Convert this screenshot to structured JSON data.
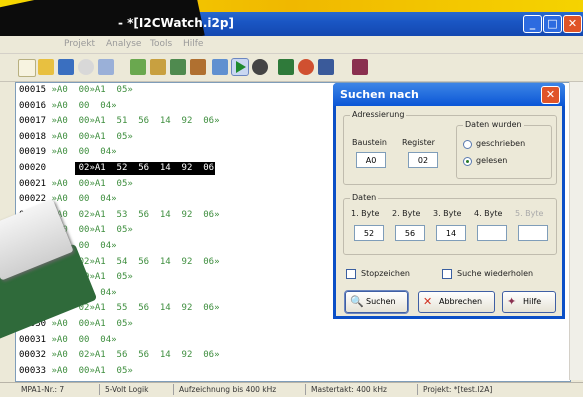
{
  "window": {
    "title": "- *[I2CWatch.i2p]",
    "controls": {
      "min": "_",
      "max": "□",
      "close": "✕"
    }
  },
  "menu": [
    "Projekt",
    "Analyse",
    "Tools",
    "Hilfe"
  ],
  "log_rows": [
    {
      "addr": "00015",
      "data": " »A0  00»A1  05»"
    },
    {
      "addr": "00016",
      "data": " »A0  00  04»"
    },
    {
      "addr": "00017",
      "data": " »A0  00»A1  51  56  14  92  06»"
    },
    {
      "addr": "00018",
      "data": " »A0  00»A1  05»"
    },
    {
      "addr": "00019",
      "data": " »A0  00  04»"
    },
    {
      "addr": "00020",
      "data": " »A0  02»A1  52  56  14  92  06»",
      "highlight": true
    },
    {
      "addr": "00021",
      "data": " »A0  00»A1  05»"
    },
    {
      "addr": "00022",
      "data": " »A0  00  04»"
    },
    {
      "addr": "00023",
      "data": " »A0  02»A1  53  56  14  92  06»"
    },
    {
      "addr": "00024",
      "data": " »A0  00»A1  05»"
    },
    {
      "addr": "00025",
      "data": " »A0  00  04»"
    },
    {
      "addr": "00026",
      "data": " »A0  02»A1  54  56  14  92  06»"
    },
    {
      "addr": "00027",
      "data": " »A0  00»A1  05»"
    },
    {
      "addr": "00028",
      "data": " »A0  00  04»"
    },
    {
      "addr": "00029",
      "data": " »A0  02»A1  55  56  14  92  06»"
    },
    {
      "addr": "00030",
      "data": " »A0  00»A1  05»"
    },
    {
      "addr": "00031",
      "data": " »A0  00  04»"
    },
    {
      "addr": "00032",
      "data": " »A0  02»A1  56  56  14  92  06»"
    },
    {
      "addr": "00033",
      "data": " »A0  00»A1  05»"
    }
  ],
  "status": [
    "MPA1-Nr.: 7",
    "5-Volt Logik",
    "Aufzeichnung bis 400 kHz",
    "Mastertakt: 400 kHz",
    "Projekt: *[test.I2A]"
  ],
  "dialog": {
    "title": "Suchen nach",
    "addressing": {
      "label": "Adressierung",
      "device_label": "Baustein",
      "device_value": "A0",
      "register_label": "Register",
      "register_value": "02",
      "data_group_label": "Daten wurden",
      "written_label": "geschrieben",
      "read_label": "gelesen",
      "selected": "read"
    },
    "data": {
      "label": "Daten",
      "byte_labels": [
        "1. Byte",
        "2. Byte",
        "3. Byte",
        "4. Byte",
        "5. Byte"
      ],
      "byte_values": [
        "52",
        "56",
        "14",
        "",
        ""
      ]
    },
    "stop_label": "Stopzeichen",
    "repeat_label": "Suche wiederholen",
    "buttons": {
      "search": "Suchen",
      "cancel": "Abbrechen",
      "help": "Hilfe"
    }
  },
  "colors": {
    "title_blue": "#0b56d6",
    "hex_green": "#3e8e3e",
    "close_red": "#e05428"
  }
}
